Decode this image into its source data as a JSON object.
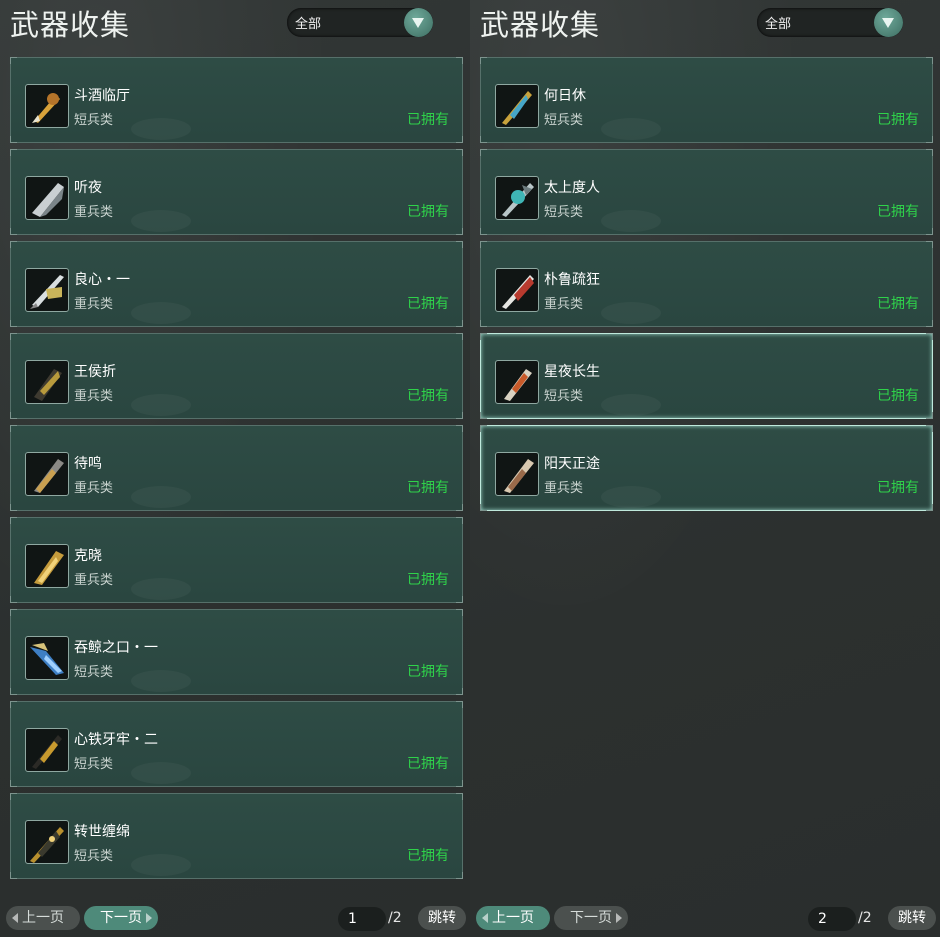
{
  "left_panel": {
    "title": "武器收集",
    "filter": "全部",
    "items": [
      {
        "name": "斗酒临厅",
        "category": "短兵类",
        "status": "已拥有"
      },
      {
        "name": "听夜",
        "category": "重兵类",
        "status": "已拥有"
      },
      {
        "name": "良心・一",
        "category": "重兵类",
        "status": "已拥有"
      },
      {
        "name": "王侯折",
        "category": "重兵类",
        "status": "已拥有"
      },
      {
        "name": "待鸣",
        "category": "重兵类",
        "status": "已拥有"
      },
      {
        "name": "克晓",
        "category": "重兵类",
        "status": "已拥有"
      },
      {
        "name": "吞鲸之口・一",
        "category": "短兵类",
        "status": "已拥有"
      },
      {
        "name": "心铁牙牢・二",
        "category": "短兵类",
        "status": "已拥有"
      },
      {
        "name": "转世缠绵",
        "category": "短兵类",
        "status": "已拥有"
      }
    ],
    "prev": "上一页",
    "next": "下一页",
    "page": "1",
    "total": "/2",
    "jump": "跳转"
  },
  "right_panel": {
    "title": "武器收集",
    "filter": "全部",
    "items": [
      {
        "name": "何日休",
        "category": "短兵类",
        "status": "已拥有"
      },
      {
        "name": "太上度人",
        "category": "短兵类",
        "status": "已拥有"
      },
      {
        "name": "朴鲁疏狂",
        "category": "重兵类",
        "status": "已拥有"
      },
      {
        "name": "星夜长生",
        "category": "短兵类",
        "status": "已拥有"
      },
      {
        "name": "阳天正途",
        "category": "重兵类",
        "status": "已拥有"
      }
    ],
    "prev": "上一页",
    "next": "下一页",
    "page": "2",
    "total": "/2",
    "jump": "跳转"
  },
  "colors": {
    "owned": "#2fd24a",
    "card_bg": "#2e4c45",
    "accent": "#4e8a7a"
  },
  "icons": [
    "chevron-down-icon",
    "weapon-icon",
    "arrow-left-icon",
    "arrow-right-icon"
  ]
}
